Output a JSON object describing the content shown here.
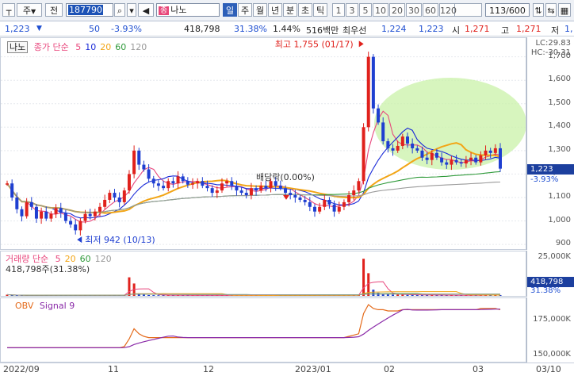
{
  "toolbar": {
    "stock_type": "주",
    "prev_label": "전",
    "code_value": "187790",
    "stock_name": "나노",
    "name_tag": "종",
    "periods": [
      "일",
      "주",
      "월",
      "년",
      "분",
      "초",
      "틱"
    ],
    "active_period": "일",
    "intervals": [
      "1",
      "3",
      "5",
      "10",
      "20",
      "30",
      "60",
      "120"
    ],
    "count_display": "113/600"
  },
  "quote": {
    "price": "1,223",
    "change": "50",
    "change_pct": "-3.93%",
    "volume": "418,798",
    "volume_ratio": "31.38%",
    "turnover_pct": "1.44%",
    "amount": "516백만",
    "best_offer_label": "최우선",
    "best_ask": "1,224",
    "best_bid": "1,223",
    "open_label": "시",
    "open": "1,271",
    "high_label": "고",
    "high": "1,271",
    "low_label": "저",
    "low_partial": "1,"
  },
  "price_pane": {
    "stock_label": "나노",
    "ma_title": "종가 단순",
    "ma_periods": [
      "5",
      "10",
      "20",
      "60",
      "120"
    ],
    "ma_colors": [
      "#e8467c",
      "#1a2ad8",
      "#f2a516",
      "#2f9a3a",
      "#9a9a9a"
    ],
    "annotation_high": "최고 1,755 (01/17)",
    "annotation_low": "최저 942 (10/13)",
    "annotation_dividend": "배당락(0.00%)",
    "lc_label": "LC:29.83",
    "hc_label": "HC:-30.31",
    "current_price_tag": "1,223",
    "current_change_tag": "-3.93%",
    "y_ticks": [
      "1,700",
      "1,600",
      "1,500",
      "1,400",
      "1,300",
      "1,200",
      "1,100",
      "1,000",
      "900"
    ]
  },
  "volume_pane": {
    "title": "거래량 단순",
    "ma_periods": [
      "5",
      "20",
      "60",
      "120"
    ],
    "ma_colors": [
      "#e8467c",
      "#f2a516",
      "#2f9a3a",
      "#9a9a9a"
    ],
    "value_text": "418,798주(31.38%)",
    "y_tick": "25,000K",
    "volume_tag": "418,798",
    "ratio_tag": "31.38%"
  },
  "obv_pane": {
    "title": "OBV",
    "signal": "Signal 9",
    "colors": [
      "#e46a1a",
      "#8a2aa8"
    ],
    "y_ticks": [
      "175,000K",
      "150,000K"
    ]
  },
  "x_axis": {
    "labels": [
      "2022/09",
      "11",
      "12",
      "2023/01",
      "02",
      "03",
      "03/10"
    ]
  },
  "chart_data": {
    "type": "candlestick",
    "title": "나노",
    "y_range": [
      880,
      1780
    ],
    "timeline": [
      "2022/09",
      "11",
      "12",
      "2023/01",
      "02",
      "03",
      "03/10"
    ],
    "moving_averages": [
      "5",
      "10",
      "20",
      "60",
      "120"
    ],
    "notes": [
      "최고 1,755 (01/17)",
      "최저 942 (10/13)",
      "배당락(0.00%)"
    ],
    "close": [
      1160,
      1100,
      1050,
      1020,
      1080,
      1060,
      1010,
      1040,
      1010,
      1030,
      1055,
      1035,
      1000,
      985,
      960,
      1000,
      1030,
      1020,
      1040,
      1060,
      1090,
      1120,
      1100,
      1080,
      1130,
      1200,
      1300,
      1240,
      1220,
      1180,
      1160,
      1150,
      1140,
      1170,
      1160,
      1190,
      1170,
      1155,
      1160,
      1170,
      1150,
      1140,
      1120,
      1130,
      1160,
      1170,
      1150,
      1130,
      1120,
      1110,
      1140,
      1130,
      1150,
      1140,
      1170,
      1150,
      1140,
      1120,
      1110,
      1100,
      1090,
      1080,
      1060,
      1040,
      1060,
      1090,
      1070,
      1040,
      1060,
      1080,
      1110,
      1130,
      1170,
      1400,
      1700,
      1480,
      1420,
      1340,
      1310,
      1300,
      1320,
      1360,
      1330,
      1310,
      1300,
      1270,
      1260,
      1290,
      1270,
      1250,
      1240,
      1260,
      1250,
      1245,
      1260,
      1270,
      1250,
      1280,
      1300,
      1290,
      1310,
      1223
    ],
    "volume": [
      60,
      30,
      25,
      20,
      18,
      22,
      40,
      20,
      30,
      25,
      35,
      25,
      30,
      30,
      40,
      28,
      30,
      22,
      25,
      35,
      30,
      28,
      40,
      25,
      35,
      900,
      600,
      120,
      60,
      40,
      35,
      30,
      40,
      25,
      20,
      28,
      25,
      30,
      20,
      25,
      25,
      22,
      30,
      25,
      20,
      28,
      26,
      22,
      25,
      20,
      25,
      22,
      25,
      30,
      25,
      22,
      25,
      22,
      20,
      22,
      25,
      20,
      30,
      25,
      22,
      25,
      22,
      28,
      25,
      30,
      28,
      35,
      60,
      1800,
      1100,
      300,
      150,
      100,
      80,
      60,
      70,
      60,
      50,
      45,
      40,
      35,
      40,
      45,
      35,
      30,
      30,
      35,
      30,
      30,
      28,
      35,
      30,
      35,
      50,
      40,
      35,
      40
    ],
    "obv": [
      151,
      151,
      151,
      151,
      151,
      151,
      151,
      151,
      151,
      151,
      151,
      151,
      151,
      151,
      151,
      151,
      151,
      151,
      151,
      151,
      151,
      151,
      151,
      151,
      152,
      158,
      166,
      162,
      160,
      159,
      159,
      159,
      159,
      159,
      159,
      159,
      159,
      159,
      159,
      159,
      159,
      159,
      159,
      159,
      159,
      159,
      159,
      159,
      159,
      159,
      159,
      159,
      159,
      159,
      159,
      159,
      159,
      159,
      159,
      159,
      159,
      159,
      159,
      159,
      159,
      159,
      159,
      159,
      159,
      159,
      160,
      161,
      162,
      178,
      185,
      182,
      181,
      181,
      180,
      180,
      180,
      181,
      181,
      181,
      181,
      181,
      181,
      181,
      181,
      181,
      181,
      181,
      181,
      181,
      181,
      181,
      181,
      182,
      182,
      182,
      182,
      181
    ],
    "obv_range": [
      140,
      190
    ],
    "volume_max": 2000
  }
}
